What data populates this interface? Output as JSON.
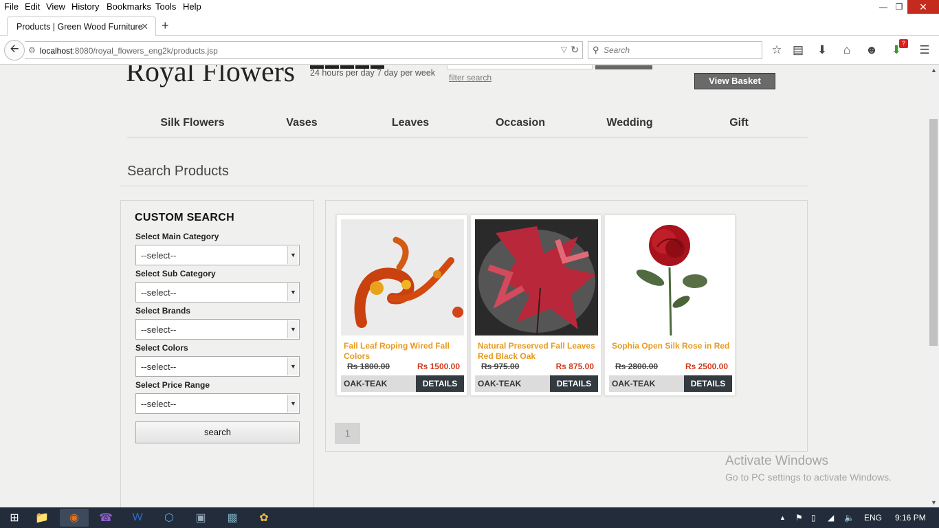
{
  "menubar": {
    "items": [
      "File",
      "Edit",
      "View",
      "History",
      "Bookmarks",
      "Tools",
      "Help"
    ]
  },
  "tab": {
    "title": "Products | Green Wood Furniture"
  },
  "address": {
    "host": "localhost",
    "rest": ":8080/royal_flowers_eng2k/products.jsp"
  },
  "browser_search": {
    "placeholder": "Search"
  },
  "site": {
    "logo": "Royal Flowers",
    "tagline": "24 hours per day 7 day per week",
    "filter_link": "filter search",
    "view_basket": "View Basket"
  },
  "categories": [
    "Silk Flowers",
    "Vases",
    "Leaves",
    "Occasion",
    "Wedding",
    "Gift"
  ],
  "page_title": "Search Products",
  "custom_search": {
    "heading": "CUSTOM SEARCH",
    "fields": [
      {
        "label": "Select Main Category",
        "value": "--select--"
      },
      {
        "label": "Select Sub Category",
        "value": "--select--"
      },
      {
        "label": "Select Brands",
        "value": "--select--"
      },
      {
        "label": "Select Colors",
        "value": "--select--"
      },
      {
        "label": "Select Price Range",
        "value": "--select--"
      }
    ],
    "button": "search"
  },
  "products": [
    {
      "name": "Fall Leaf Roping Wired Fall Colors",
      "old_price": "Rs 1800.00",
      "price": "Rs 1500.00",
      "material": "OAK-TEAK",
      "action": "DETAILS"
    },
    {
      "name": "Natural Preserved Fall Leaves Red Black Oak",
      "old_price": "Rs 975.00",
      "price": "Rs 875.00",
      "material": "OAK-TEAK",
      "action": "DETAILS"
    },
    {
      "name": "Sophia Open Silk Rose in Red",
      "old_price": "Rs 2800.00",
      "price": "Rs 2500.00",
      "material": "OAK-TEAK",
      "action": "DETAILS"
    }
  ],
  "pagination": {
    "current": "1"
  },
  "watermark": {
    "line1": "Activate Windows",
    "line2": "Go to PC settings to activate Windows."
  },
  "tray": {
    "lang": "ENG",
    "time": "9:16 PM",
    "badge": "?"
  },
  "colors": {
    "accent_orange": "#e89a1d",
    "price_red": "#d0391b",
    "button_dark": "#333a40"
  }
}
